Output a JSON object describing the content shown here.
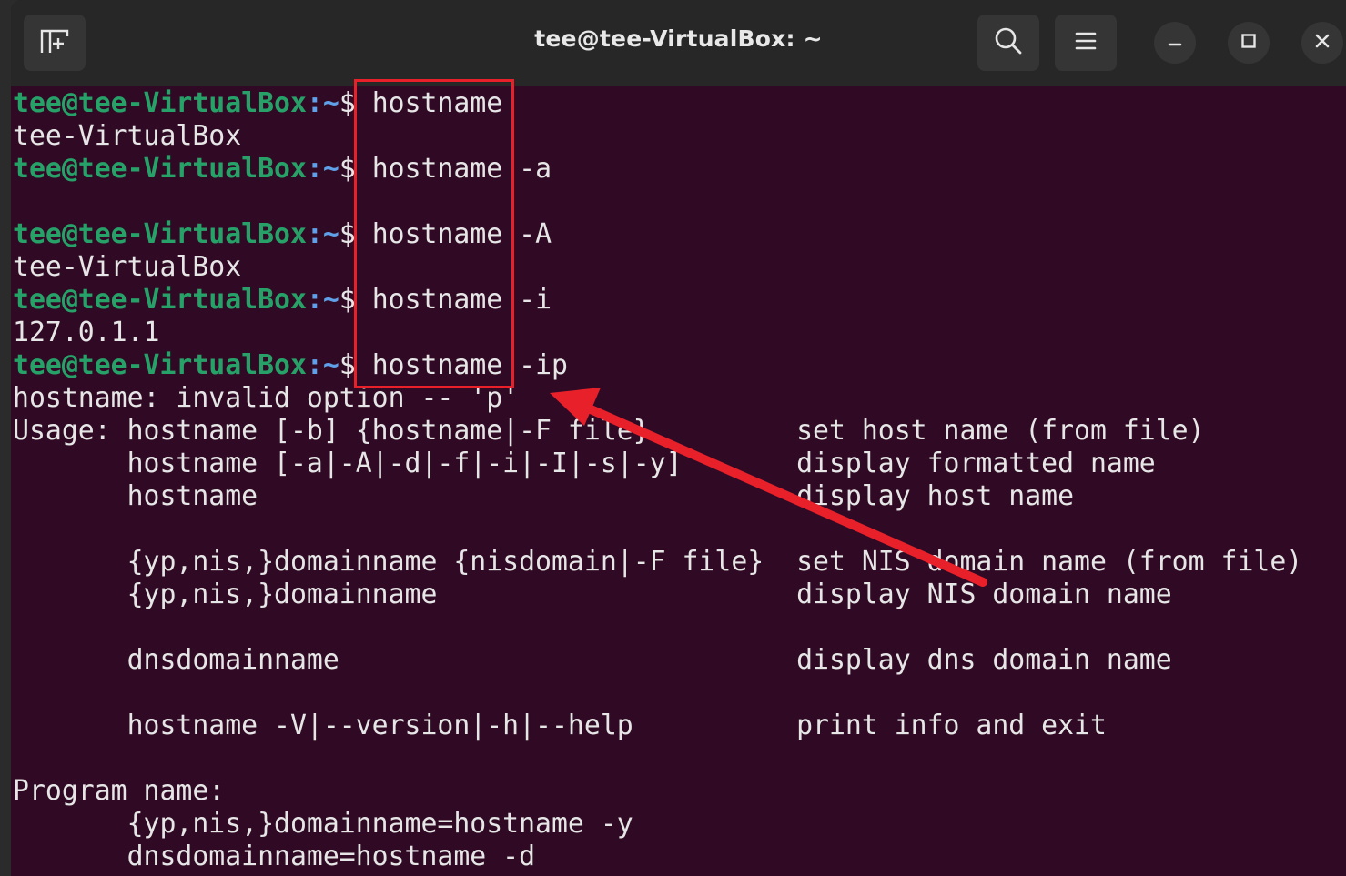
{
  "window": {
    "title": "tee@tee-VirtualBox: ~",
    "buttons": {
      "new_tab_icon": "new-tab-icon",
      "search_icon": "search-icon",
      "menu_icon": "hamburger-menu-icon",
      "minimize_icon": "minimize-icon",
      "maximize_icon": "maximize-icon",
      "close_icon": "close-icon"
    }
  },
  "colors": {
    "terminal_bg": "#300a24",
    "prompt_user": "#26a269",
    "prompt_path": "#5fa0e8",
    "text": "#e6e6e6",
    "annotation_red": "#e8202a"
  },
  "prompt": {
    "user": "tee@tee-VirtualBox",
    "path": ":~",
    "symbol": "$ "
  },
  "lines": [
    {
      "type": "cmd",
      "cmd": "hostname"
    },
    {
      "type": "out",
      "text": "tee-VirtualBox"
    },
    {
      "type": "cmd",
      "cmd": "hostname -a"
    },
    {
      "type": "out",
      "text": ""
    },
    {
      "type": "cmd",
      "cmd": "hostname -A"
    },
    {
      "type": "out",
      "text": "tee-VirtualBox"
    },
    {
      "type": "cmd",
      "cmd": "hostname -i"
    },
    {
      "type": "out",
      "text": "127.0.1.1"
    },
    {
      "type": "cmd",
      "cmd": "hostname -ip"
    },
    {
      "type": "out",
      "text": "hostname: invalid option -- 'p'"
    },
    {
      "type": "out",
      "text": "Usage: hostname [-b] {hostname|-F file}         set host name (from file)"
    },
    {
      "type": "out",
      "text": "       hostname [-a|-A|-d|-f|-i|-I|-s|-y]       display formatted name"
    },
    {
      "type": "out",
      "text": "       hostname                                 display host name"
    },
    {
      "type": "out",
      "text": ""
    },
    {
      "type": "out",
      "text": "       {yp,nis,}domainname {nisdomain|-F file}  set NIS domain name (from file)"
    },
    {
      "type": "out",
      "text": "       {yp,nis,}domainname                      display NIS domain name"
    },
    {
      "type": "out",
      "text": ""
    },
    {
      "type": "out",
      "text": "       dnsdomainname                            display dns domain name"
    },
    {
      "type": "out",
      "text": ""
    },
    {
      "type": "out",
      "text": "       hostname -V|--version|-h|--help          print info and exit"
    },
    {
      "type": "out",
      "text": ""
    },
    {
      "type": "out",
      "text": "Program name:"
    },
    {
      "type": "out",
      "text": "       {yp,nis,}domainname=hostname -y"
    },
    {
      "type": "out",
      "text": "       dnsdomainname=hostname -d"
    }
  ]
}
